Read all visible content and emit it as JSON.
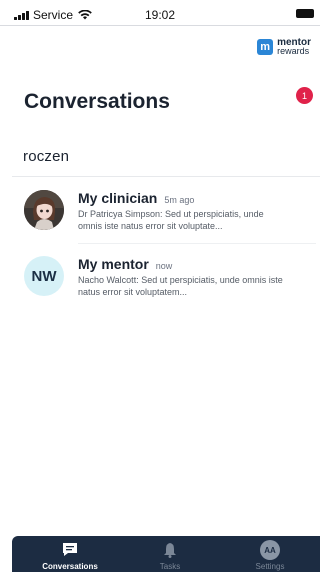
{
  "status_bar": {
    "carrier": "Service",
    "time": "19:02"
  },
  "brand": {
    "mark": "m",
    "line1": "mentor",
    "line2": "rewards"
  },
  "page": {
    "title": "Conversations",
    "user_name": "roczen"
  },
  "conversations": [
    {
      "title": "My clinician",
      "time": "5m ago",
      "preview": "Dr Patricya Simpson: Sed ut perspiciatis, unde omnis iste natus error sit voluptate...",
      "avatar": "photo",
      "unread": null
    },
    {
      "title": "My mentor",
      "time": "now",
      "preview": "Nacho Walcott: Sed ut perspiciatis, unde omnis iste natus error sit voluptatem...",
      "avatar_initials": "NW",
      "unread": "1"
    }
  ],
  "tabs": [
    {
      "label": "Conversations",
      "icon": "chat-icon",
      "active": true
    },
    {
      "label": "Tasks",
      "icon": "bell-icon",
      "active": false
    },
    {
      "label": "Settings",
      "icon": "profile-initials-icon",
      "initials": "AA",
      "active": false
    }
  ],
  "colors": {
    "accent": "#2b86d6",
    "badge": "#e0224a",
    "tabbar": "#1c2c42",
    "avatar_initials_bg": "#d6f1f7"
  }
}
